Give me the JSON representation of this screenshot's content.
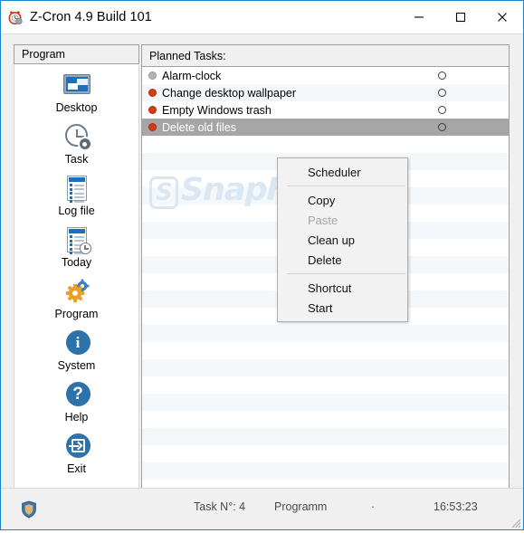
{
  "window": {
    "title": "Z-Cron 4.9 Build 101",
    "icon": "alarm-clock-icon",
    "controls": {
      "minimize": "minimize-icon",
      "maximize": "maximize-icon",
      "close": "close-icon"
    },
    "accent_color": "#1884ce"
  },
  "sidebar": {
    "group_label": "Program",
    "items": [
      {
        "label": "Desktop",
        "icon": "monitor-icon"
      },
      {
        "label": "Task",
        "icon": "clock-gear-icon"
      },
      {
        "label": "Log file",
        "icon": "document-list-icon"
      },
      {
        "label": "Today",
        "icon": "document-clock-icon"
      },
      {
        "label": "Program",
        "icon": "gears-icon"
      },
      {
        "label": "System",
        "icon": "info-circle-icon"
      },
      {
        "label": "Help",
        "icon": "question-circle-icon"
      },
      {
        "label": "Exit",
        "icon": "exit-arrow-icon"
      }
    ]
  },
  "task_list": {
    "header": "Planned Tasks:",
    "rows": [
      {
        "name": "Alarm-clock",
        "status": "disabled",
        "selected": false,
        "radio": false
      },
      {
        "name": "Change desktop wallpaper",
        "status": "active",
        "selected": false,
        "radio": false
      },
      {
        "name": "Empty Windows trash",
        "status": "active",
        "selected": false,
        "radio": false
      },
      {
        "name": "Delete old files",
        "status": "active",
        "selected": true,
        "radio": false
      }
    ],
    "status_colors": {
      "active": "#d93a16",
      "disabled": "#b4b4b4"
    },
    "selection_color": "#a6a6a6",
    "watermark": "SnapFiles",
    "watermark_badge": "S"
  },
  "context_menu": {
    "items": [
      {
        "label": "Scheduler",
        "enabled": true
      },
      {
        "type": "separator"
      },
      {
        "label": "Copy",
        "enabled": true
      },
      {
        "label": "Paste",
        "enabled": false
      },
      {
        "label": "Clean up",
        "enabled": true
      },
      {
        "label": "Delete",
        "enabled": true
      },
      {
        "type": "separator"
      },
      {
        "label": "Shortcut",
        "enabled": true
      },
      {
        "label": "Start",
        "enabled": true
      }
    ]
  },
  "status_bar": {
    "shield_icon": "shield-icon",
    "task_count": "Task N°: 4",
    "mode": "Programm",
    "separator_dot": "·",
    "time": "16:53:23",
    "grip": "resize-grip-icon"
  }
}
